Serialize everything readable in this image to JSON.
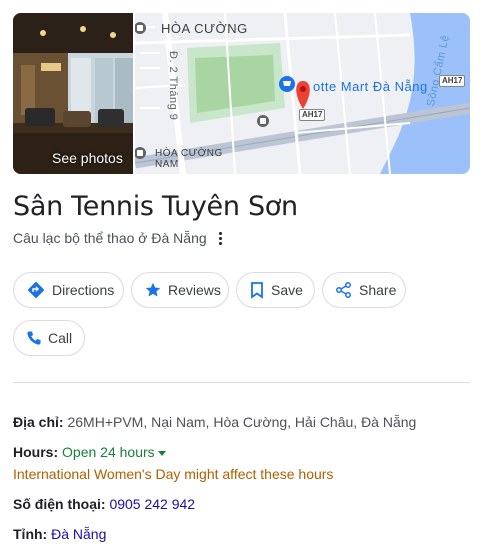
{
  "media": {
    "see_photos": "See photos",
    "map": {
      "labels": {
        "district_top": "HÒA CƯỜNG",
        "district_bottom_line1": "HÒA CƯỜNG",
        "district_bottom_line2": "NAM",
        "street": "Đ. 2 Tháng 9",
        "poi": "otte Mart Đà Nẵng",
        "river": "Sông Cẩm Lệ",
        "highway_a": "AH17",
        "highway_b": "AH17"
      },
      "expand_icon": "expand-icon",
      "pin_icon": "map-pin-icon",
      "poi_icon": "shopping-cart-icon"
    }
  },
  "place": {
    "name": "Sân Tennis Tuyên Sơn",
    "category": "Câu lạc bộ thể thao ở Đà Nẵng"
  },
  "actions": {
    "directions": "Directions",
    "reviews": "Reviews",
    "save": "Save",
    "share": "Share",
    "call": "Call"
  },
  "details": {
    "address_label": "Địa chỉ:",
    "address_value": "26MH+PVM, Nại Nam, Hòa Cường, Hải Châu, Đà Nẵng",
    "hours_label": "Hours:",
    "hours_value": "Open 24 hours",
    "hours_notice": "International Women's Day might affect these hours",
    "phone_label": "Số điện thoại:",
    "phone_value": "0905 242 942",
    "province_label": "Tỉnh:",
    "province_value": "Đà Nẵng"
  },
  "colors": {
    "link": "#1a0dab",
    "open_green": "#188038",
    "notice_orange": "#b06000",
    "accent_blue": "#1a73e8"
  }
}
